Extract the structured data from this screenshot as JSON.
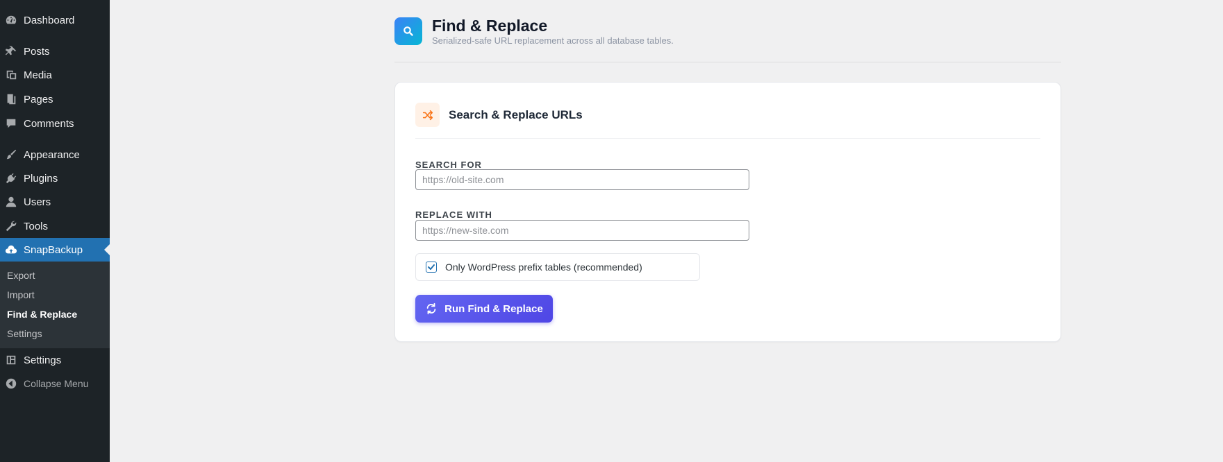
{
  "sidebar": {
    "items": [
      {
        "label": "Dashboard",
        "icon": "dashboard-icon"
      },
      {
        "label": "Posts",
        "icon": "pin-icon"
      },
      {
        "label": "Media",
        "icon": "media-icon"
      },
      {
        "label": "Pages",
        "icon": "pages-icon"
      },
      {
        "label": "Comments",
        "icon": "comment-icon"
      },
      {
        "label": "Appearance",
        "icon": "brush-icon"
      },
      {
        "label": "Plugins",
        "icon": "plug-icon"
      },
      {
        "label": "Users",
        "icon": "user-icon"
      },
      {
        "label": "Tools",
        "icon": "wrench-icon"
      },
      {
        "label": "SnapBackup",
        "icon": "cloud-upload-icon"
      },
      {
        "label": "Settings",
        "icon": "settings-icon"
      }
    ],
    "submenu": [
      "Export",
      "Import",
      "Find & Replace",
      "Settings"
    ],
    "collapse_label": "Collapse Menu",
    "accent": "#2271b1"
  },
  "header": {
    "title": "Find & Replace",
    "subtitle": "Serialized-safe URL replacement across all database tables.",
    "icon": "search-icon"
  },
  "card": {
    "title": "Search & Replace URLs",
    "icon": "shuffle-icon",
    "search_label": "SEARCH FOR",
    "search_placeholder": "https://old-site.com",
    "replace_label": "REPLACE WITH",
    "replace_placeholder": "https://new-site.com",
    "checkbox_label": "Only WordPress prefix tables (recommended)",
    "checkbox_checked": true,
    "run_label": "Run Find & Replace"
  }
}
